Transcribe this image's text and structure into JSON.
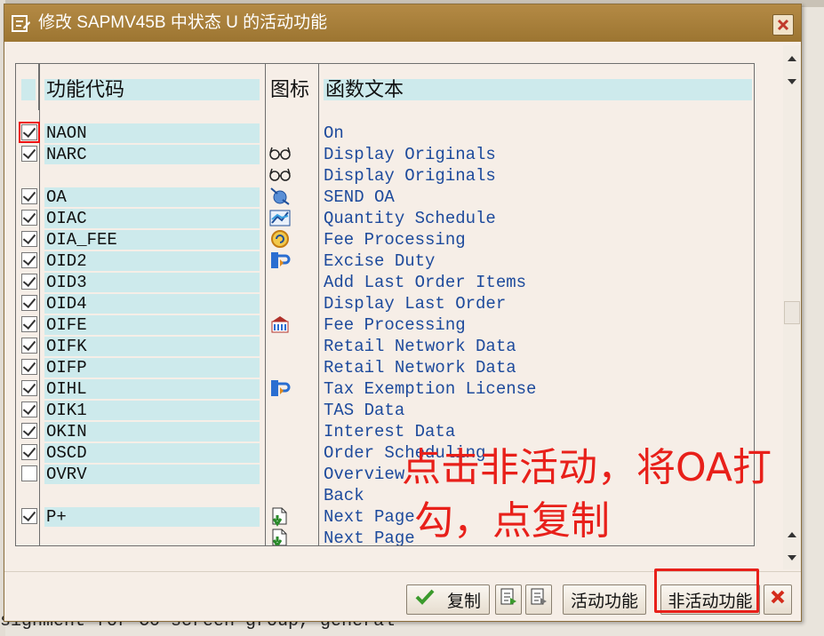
{
  "background": {
    "footer_text": "signment for C0 screen group, general"
  },
  "dialog": {
    "title": "修改 SAPMV45B 中状态 U 的活动功能",
    "close_icon": "close-icon"
  },
  "table": {
    "headers": {
      "code": "功能代码",
      "icon": "图标",
      "text": "函数文本"
    },
    "rows": [
      {
        "checked": true,
        "code": "NAON",
        "icon": "",
        "text": "On",
        "highlight": true
      },
      {
        "checked": true,
        "code": "NARC",
        "icon": "glasses-icon",
        "text": "Display Originals"
      },
      {
        "checked": null,
        "code": "",
        "icon": "glasses-icon",
        "text": "Display Originals"
      },
      {
        "checked": true,
        "code": "OA",
        "icon": "send-icon",
        "text": "SEND OA"
      },
      {
        "checked": true,
        "code": "OIAC",
        "icon": "chart-icon",
        "text": "Quantity Schedule"
      },
      {
        "checked": true,
        "code": "OIA_FEE",
        "icon": "fee-icon",
        "text": "Fee Processing"
      },
      {
        "checked": true,
        "code": "OID2",
        "icon": "duty-icon",
        "text": "Excise Duty"
      },
      {
        "checked": true,
        "code": "OID3",
        "icon": "",
        "text": "Add Last Order Items"
      },
      {
        "checked": true,
        "code": "OID4",
        "icon": "",
        "text": "Display Last Order"
      },
      {
        "checked": true,
        "code": "OIFE",
        "icon": "building-icon",
        "text": "Fee Processing"
      },
      {
        "checked": true,
        "code": "OIFK",
        "icon": "",
        "text": "Retail Network Data"
      },
      {
        "checked": true,
        "code": "OIFP",
        "icon": "",
        "text": "Retail Network Data"
      },
      {
        "checked": true,
        "code": "OIHL",
        "icon": "duty-icon",
        "text": "Tax Exemption License"
      },
      {
        "checked": true,
        "code": "OIK1",
        "icon": "",
        "text": "TAS Data"
      },
      {
        "checked": true,
        "code": "OKIN",
        "icon": "",
        "text": "Interest Data"
      },
      {
        "checked": true,
        "code": "OSCD",
        "icon": "",
        "text": "Order Scheduling"
      },
      {
        "checked": false,
        "code": "OVRV",
        "icon": "",
        "text": "Overview"
      },
      {
        "checked": null,
        "code": "",
        "icon": "",
        "text": "Back"
      },
      {
        "checked": true,
        "code": "P+",
        "icon": "page-down-icon",
        "text": "Next Page"
      },
      {
        "checked": null,
        "code": "",
        "icon": "page-down-icon",
        "text": "Next Page"
      }
    ]
  },
  "buttons": {
    "copy": "复制",
    "active": "活动功能",
    "inactive": "非活动功能"
  },
  "annotation": {
    "line1": "点击非活动，将OA打",
    "line2": "勾，点复制"
  },
  "colors": {
    "title_bar": "#a67d38",
    "header_cell": "#cdeaec",
    "function_text": "#1d4a9c",
    "annotation": "#e8201a"
  }
}
